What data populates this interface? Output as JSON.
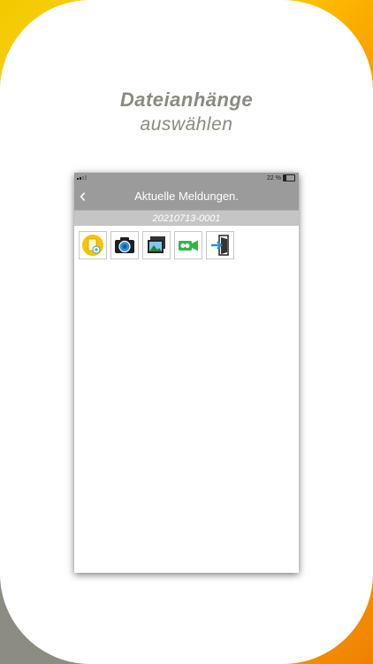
{
  "headline": {
    "line1": "Dateianhänge",
    "line2": "auswählen"
  },
  "status": {
    "battery": "22 %"
  },
  "nav": {
    "back": "‹",
    "title": "Aktuelle Meldungen."
  },
  "record": {
    "id": "20210713-0001"
  },
  "toolbar": {
    "items": [
      {
        "icon": "document-add-icon"
      },
      {
        "icon": "camera-icon"
      },
      {
        "icon": "gallery-icon"
      },
      {
        "icon": "video-camera-icon"
      },
      {
        "icon": "import-door-icon"
      }
    ]
  },
  "colors": {
    "bar": "#9b9b9b",
    "subbar": "#c5c5c5",
    "accent_yellow": "#ffd21a",
    "accent_orange": "#f79a00"
  }
}
